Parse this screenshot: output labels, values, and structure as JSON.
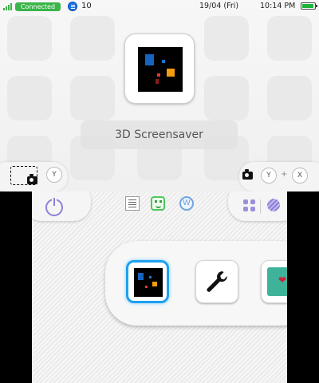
{
  "status": {
    "connection": "Connected",
    "coins": "10",
    "date": "19/04 (Fri)",
    "time": "10:14 PM"
  },
  "top": {
    "app_title": "3D Screensaver",
    "buttons": {
      "y_label": "Y",
      "plus": "+",
      "x_label": "X"
    }
  },
  "bottom": {
    "dock_apps": [
      {
        "name": "3D Screensaver",
        "selected": true
      },
      {
        "name": "System Settings",
        "selected": false
      },
      {
        "name": "Health and Safety Information",
        "selected": false
      }
    ]
  },
  "colors": {
    "accent_selection": "#1ea0f0",
    "connected_green": "#3ab54a",
    "home_purple": "#8f7fd6"
  }
}
